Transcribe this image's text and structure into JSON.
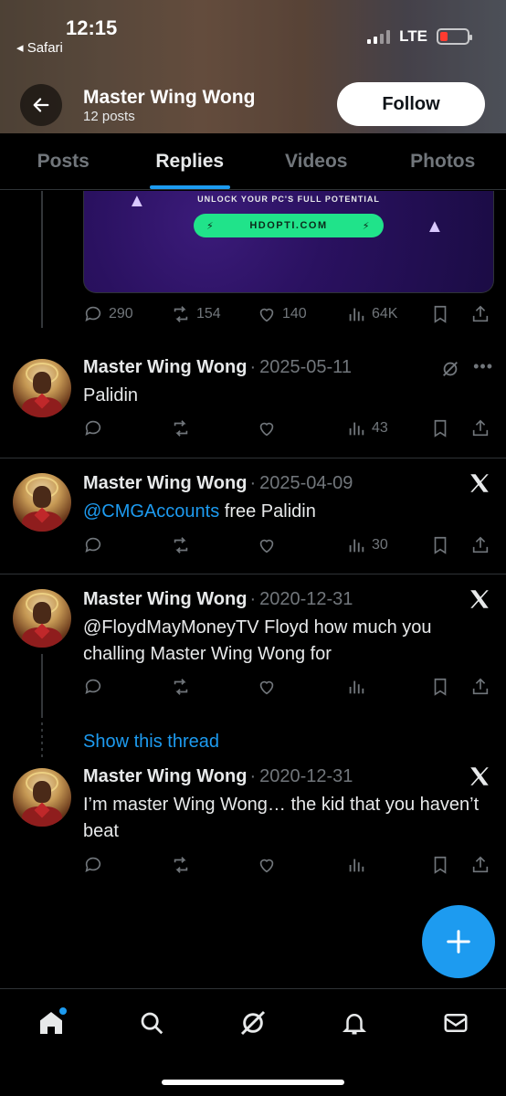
{
  "status_bar": {
    "time": "12:15",
    "back_app": "◂ Safari",
    "network": "LTE"
  },
  "header": {
    "name": "Master Wing Wong",
    "posts_count": "12 posts",
    "follow_label": "Follow"
  },
  "tabs": [
    {
      "label": "Posts"
    },
    {
      "label": "Replies"
    },
    {
      "label": "Videos"
    },
    {
      "label": "Photos"
    }
  ],
  "promo": {
    "tagline": "UNLOCK YOUR PC'S FULL POTENTIAL",
    "button_text": "HDOPTI.COM",
    "stats": {
      "replies": "290",
      "reposts": "154",
      "likes": "140",
      "views": "64K"
    }
  },
  "posts": [
    {
      "name": "Master Wing Wong",
      "date": "2025-05-11",
      "text": "Palidin",
      "views": "43"
    },
    {
      "name": "Master Wing Wong",
      "date": "2025-04-09",
      "mention": "@CMGAccounts",
      "text": " free Palidin",
      "views": "30"
    },
    {
      "name": "Master Wing Wong",
      "date": "2020-12-31",
      "text": "@FloydMayMoneyTV Floyd how much you challing Master Wing Wong for",
      "views": ""
    },
    {
      "name": "Master Wing Wong",
      "date": "2020-12-31",
      "text": "I’m master Wing Wong… the kid that you haven’t beat",
      "views": ""
    }
  ],
  "show_thread_label": "Show this thread",
  "colors": {
    "accent": "#1d9bf0",
    "background": "#000000",
    "muted": "#71767b",
    "promo_button": "#20e38a"
  }
}
